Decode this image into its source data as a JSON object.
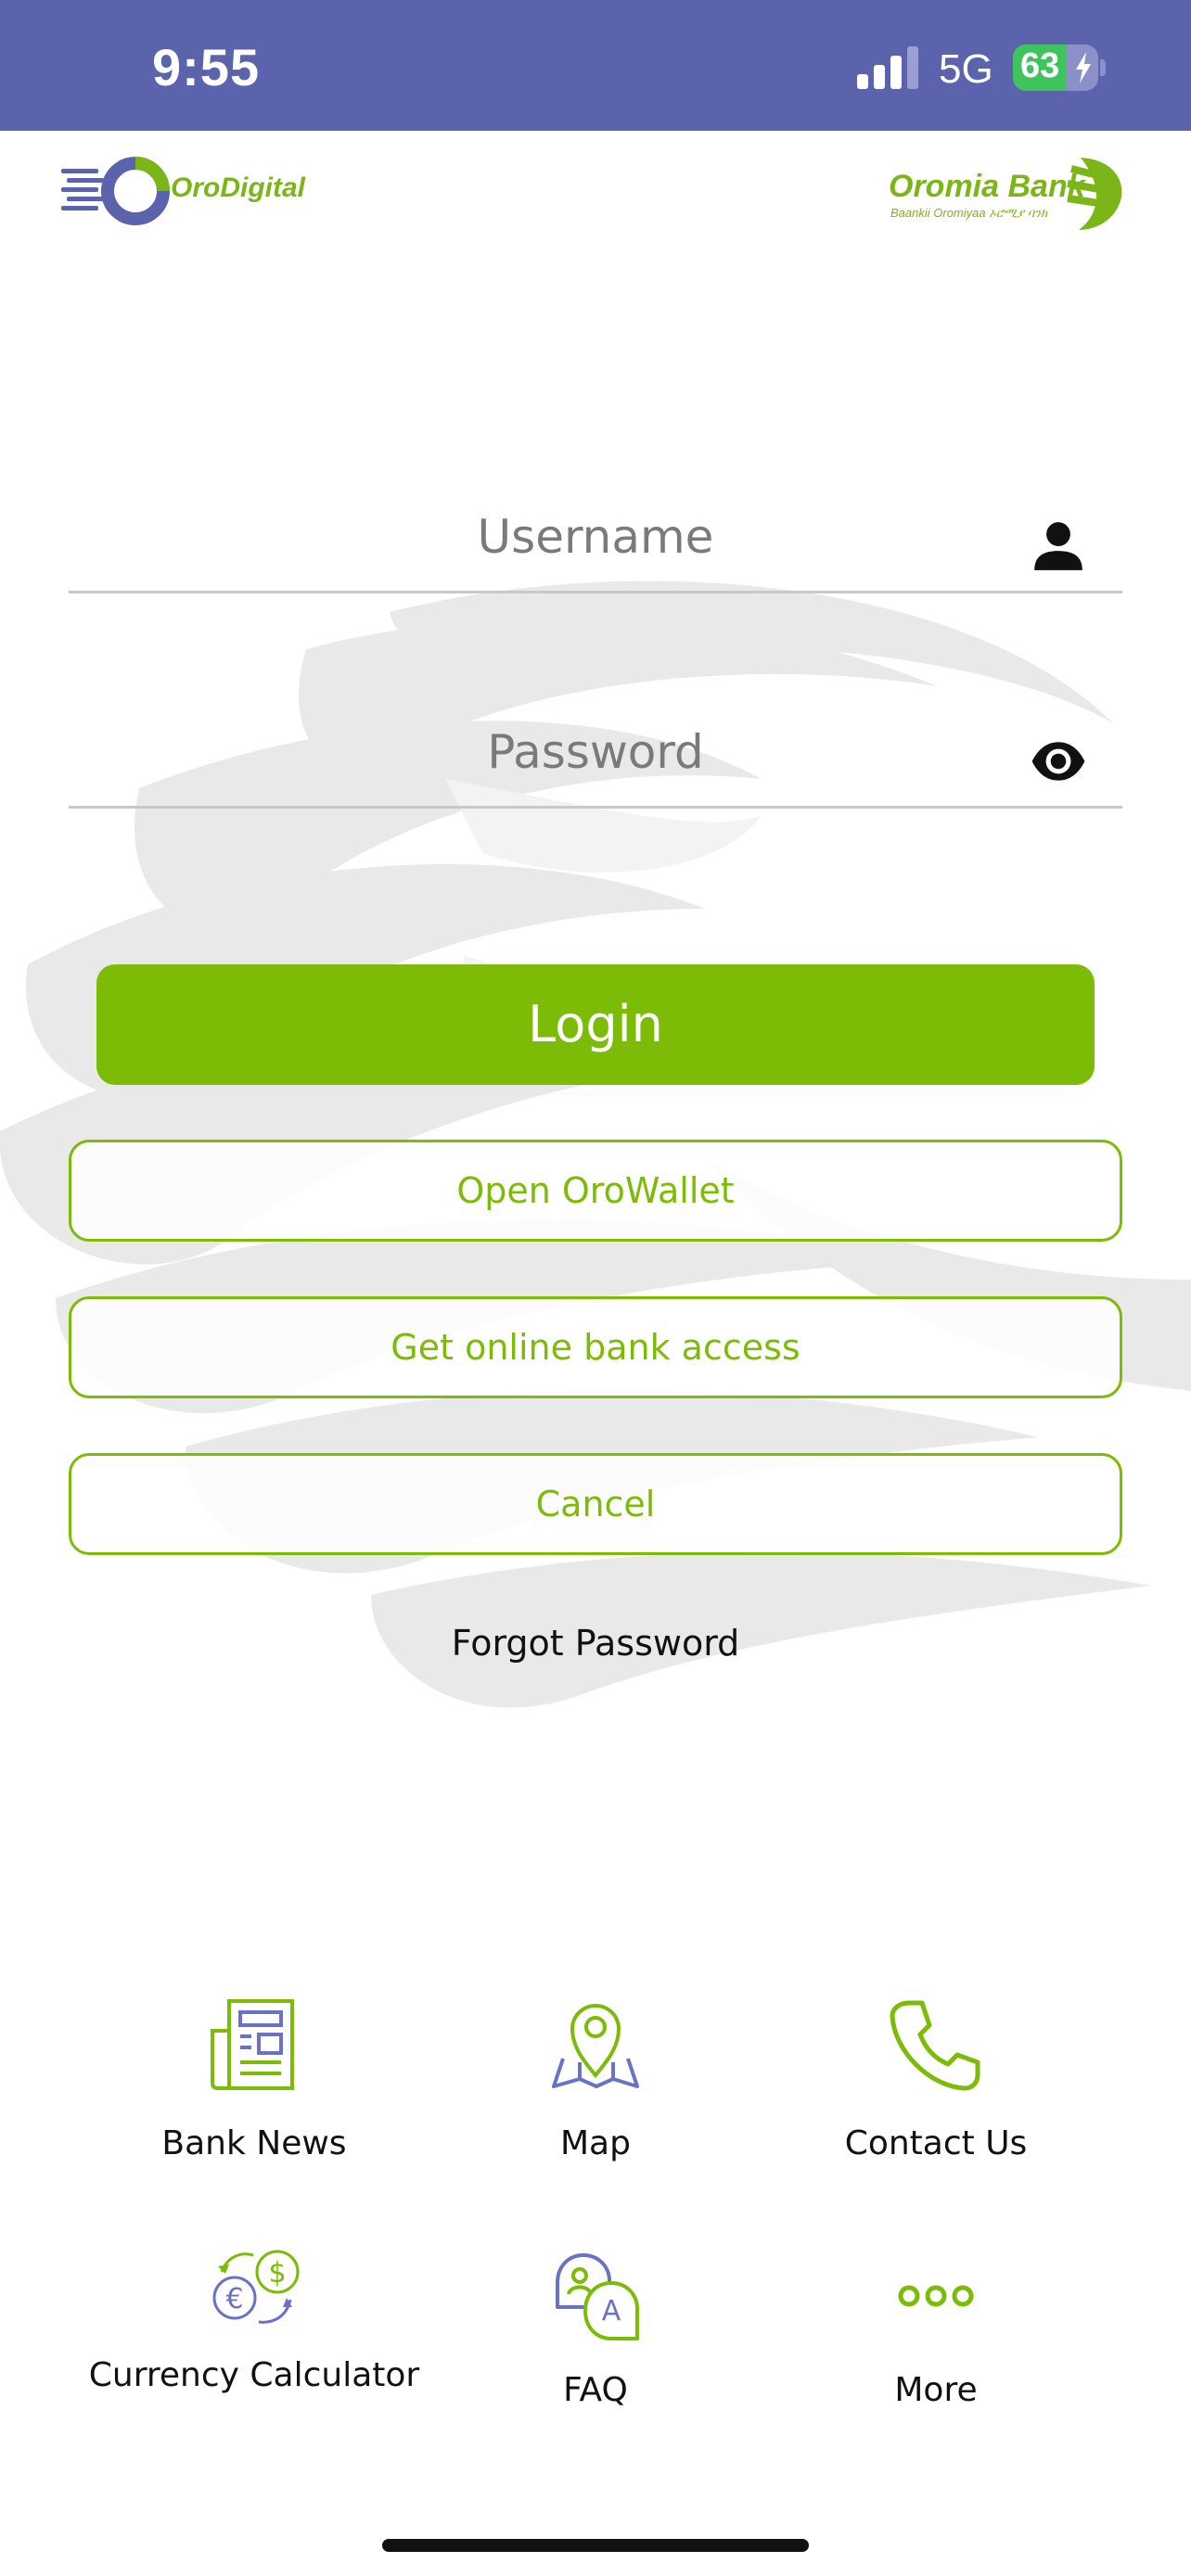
{
  "status_bar": {
    "time": "9:55",
    "network": "5G",
    "battery_percent": 63,
    "battery_label": "63",
    "background_color": "#5a63ab"
  },
  "header": {
    "left_logo_text": "OroDigital",
    "right_logo_text": "Oromia Bank",
    "right_logo_subtext": "Baankii Oromiyaa ኦሮሚያ ባንክ"
  },
  "form": {
    "username_placeholder": "Username",
    "password_placeholder": "Password",
    "username_icon": "person-icon",
    "password_icon": "eye-icon"
  },
  "actions": {
    "login_label": "Login",
    "open_wallet_label": "Open OroWallet",
    "online_access_label": "Get online bank access",
    "cancel_label": "Cancel",
    "forgot_password_label": "Forgot Password"
  },
  "quick_links": [
    {
      "label": "Bank News",
      "icon": "newspaper-icon"
    },
    {
      "label": "Map",
      "icon": "map-pin-icon"
    },
    {
      "label": "Contact Us",
      "icon": "phone-icon"
    },
    {
      "label": "Currency Calculator",
      "icon": "currency-exchange-icon"
    },
    {
      "label": "FAQ",
      "icon": "chat-bubbles-icon"
    },
    {
      "label": "More",
      "icon": "more-dots-icon"
    }
  ],
  "colors": {
    "accent_green": "#7cbb06",
    "accent_purple": "#6a72c6"
  }
}
